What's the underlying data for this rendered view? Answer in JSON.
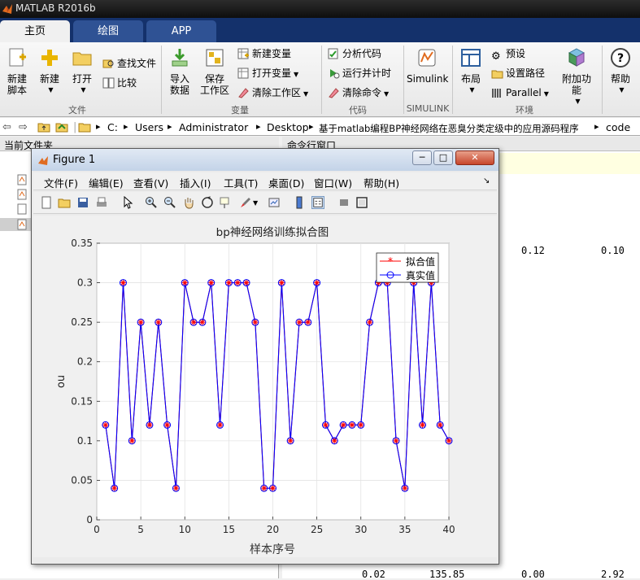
{
  "window": {
    "title": "MATLAB R2016b"
  },
  "tabs": [
    {
      "label": "主页"
    },
    {
      "label": "绘图"
    },
    {
      "label": "APP"
    }
  ],
  "ribbon": {
    "new_script": "新建\n脚本",
    "new": "新建",
    "open": "打开",
    "find_files": "查找文件",
    "compare": "比较",
    "import_data": "导入\n数据",
    "save_workspace": "保存\n工作区",
    "new_variable": "新建变量",
    "open_variable": "打开变量",
    "clear_workspace": "清除工作区",
    "analyze_code": "分析代码",
    "run_and_time": "运行并计时",
    "clear_commands": "清除命令",
    "simulink": "Simulink",
    "layout": "布局",
    "preferences": "预设",
    "set_path": "设置路径",
    "parallel": "Parallel",
    "add_ons": "附加功能",
    "help": "帮助",
    "group_file": "文件",
    "group_variable": "变量",
    "group_code": "代码",
    "group_simulink": "SIMULINK",
    "group_environment": "环境"
  },
  "address": {
    "crumbs": [
      "C:",
      "Users",
      "Administrator",
      "Desktop",
      "基于matlab编程BP神经网络在恶臭分类定级中的应用源码程序",
      "code"
    ]
  },
  "panels": {
    "current_folder": "当前文件夹",
    "command_window": "命令行窗口"
  },
  "command_output": {
    "row1": [
      "0.12",
      "0.10"
    ],
    "row2": [
      "0.02",
      "135.85",
      "0.00",
      "2.92"
    ]
  },
  "figure": {
    "title": "Figure 1",
    "menu": [
      "文件(F)",
      "编辑(E)",
      "查看(V)",
      "插入(I)",
      "工具(T)",
      "桌面(D)",
      "窗口(W)",
      "帮助(H)"
    ],
    "window_buttons": {
      "minimize": "─",
      "maximize": "□",
      "close": "✕"
    }
  },
  "colors": {
    "fit": "#ff0000",
    "actual": "#0000ff",
    "accent": "#14316b"
  },
  "chart_data": {
    "type": "line",
    "title": "bp神经网络训练拟合图",
    "xlabel": "样本序号",
    "ylabel": "ou",
    "xlim": [
      0,
      40
    ],
    "ylim": [
      0,
      0.35
    ],
    "xticks": [
      "0",
      "5",
      "10",
      "15",
      "20",
      "25",
      "30",
      "35",
      "40"
    ],
    "yticks": [
      "0",
      "0.05",
      "0.1",
      "0.15",
      "0.2",
      "0.25",
      "0.3",
      "0.35"
    ],
    "grid": true,
    "legend_position": "top-right",
    "x": [
      1,
      2,
      3,
      4,
      5,
      6,
      7,
      8,
      9,
      10,
      11,
      12,
      13,
      14,
      15,
      16,
      17,
      18,
      19,
      20,
      21,
      22,
      23,
      24,
      25,
      26,
      27,
      28,
      29,
      30,
      31,
      32,
      33,
      34,
      35,
      36,
      37,
      38,
      39,
      40
    ],
    "series": [
      {
        "name": "拟合值",
        "marker": "*",
        "values": [
          0.12,
          0.04,
          0.3,
          0.1,
          0.25,
          0.12,
          0.25,
          0.12,
          0.04,
          0.3,
          0.25,
          0.25,
          0.3,
          0.12,
          0.3,
          0.3,
          0.3,
          0.25,
          0.04,
          0.04,
          0.3,
          0.1,
          0.25,
          0.25,
          0.3,
          0.12,
          0.1,
          0.12,
          0.12,
          0.12,
          0.25,
          0.3,
          0.3,
          0.1,
          0.04,
          0.3,
          0.12,
          0.3,
          0.12,
          0.1
        ]
      },
      {
        "name": "真实值",
        "marker": "o",
        "values": [
          0.12,
          0.04,
          0.3,
          0.1,
          0.25,
          0.12,
          0.25,
          0.12,
          0.04,
          0.3,
          0.25,
          0.25,
          0.3,
          0.12,
          0.3,
          0.3,
          0.3,
          0.25,
          0.04,
          0.04,
          0.3,
          0.1,
          0.25,
          0.25,
          0.3,
          0.12,
          0.1,
          0.12,
          0.12,
          0.12,
          0.25,
          0.3,
          0.3,
          0.1,
          0.04,
          0.3,
          0.12,
          0.3,
          0.12,
          0.1
        ]
      }
    ]
  }
}
